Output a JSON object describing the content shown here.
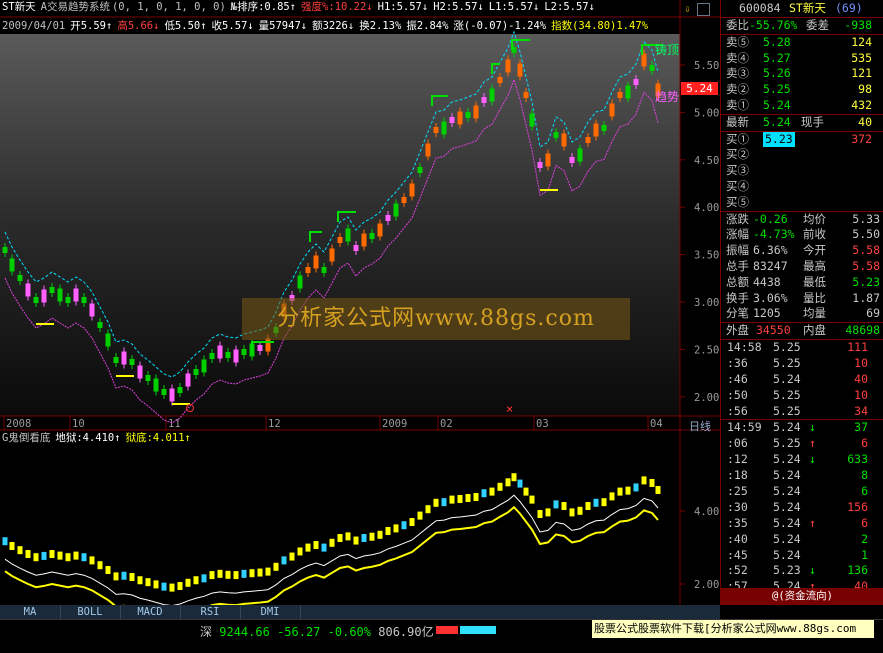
{
  "header": {
    "stock_name": "ST新天",
    "indicator_name": "A交易趋势系统",
    "indicator_params": "(0, 1, 0, 1, 0, 0)",
    "rank": "№排序:0.85↑",
    "strength": "强度%:10.22↓",
    "h1": "H1:5.57↓",
    "h2": "H2:5.57↓",
    "l1": "L1:5.57↓",
    "l2": "L2:5.57↓",
    "date": "2009/04/01",
    "open": "开5.59↑",
    "high": "高5.66↓",
    "low": "低5.50↑",
    "close": "收5.57↓",
    "volume": "量57947↓",
    "amount": "额3226↓",
    "turnover": "换2.13%",
    "amplitude": "振2.84%",
    "change": "涨(-0.07)-1.24%",
    "index": "指数(34.80)1.47%"
  },
  "labels": {
    "top_tag": "铸顶",
    "trend_tag": "趋势",
    "price_tag": "5.24",
    "period": "日线",
    "watermark": "分析家公式网www.88gs.com",
    "sub_title": "G鬼倒看底",
    "sub_hell": "地狱:4.410↑",
    "sub_bottom": "狱底:4.011↑"
  },
  "y_axis_main": [
    "5.50",
    "5.00",
    "4.50",
    "4.00",
    "3.50",
    "3.00",
    "2.50",
    "2.00"
  ],
  "y_axis_sub": [
    "4.00",
    "2.00"
  ],
  "x_axis": [
    "2008",
    "10",
    "11",
    "12",
    "2009",
    "02",
    "03",
    "04"
  ],
  "tabs": [
    "MA",
    "BOLL",
    "MACD",
    "RSI",
    "DMI"
  ],
  "quote": {
    "code": "600084",
    "name": "ST新天",
    "rank": "(69)",
    "ratio_label": "委比",
    "ratio_value": "-55.76%",
    "diff_label": "委差",
    "diff_value": "-938",
    "asks": [
      {
        "label": "卖⑤",
        "price": "5.28",
        "vol": "124"
      },
      {
        "label": "卖④",
        "price": "5.27",
        "vol": "535"
      },
      {
        "label": "卖③",
        "price": "5.26",
        "vol": "121"
      },
      {
        "label": "卖②",
        "price": "5.25",
        "vol": "98"
      },
      {
        "label": "卖①",
        "price": "5.24",
        "vol": "432"
      }
    ],
    "last_label": "最新",
    "last_value": "5.24",
    "curvol_label": "现手",
    "curvol_value": "40",
    "bids": [
      {
        "label": "买①",
        "price": "5.23",
        "vol": "372"
      },
      {
        "label": "买②",
        "price": "",
        "vol": ""
      },
      {
        "label": "买③",
        "price": "",
        "vol": ""
      },
      {
        "label": "买④",
        "price": "",
        "vol": ""
      },
      {
        "label": "买⑤",
        "price": "",
        "vol": ""
      }
    ],
    "stats": [
      {
        "l1": "涨跌",
        "v1": "-0.26",
        "l2": "均价",
        "v2": "5.33",
        "c1": "#00e000",
        "c2": "#c8c8c8"
      },
      {
        "l1": "涨幅",
        "v1": "-4.73%",
        "l2": "前收",
        "v2": "5.50",
        "c1": "#00e000",
        "c2": "#c8c8c8"
      },
      {
        "l1": "振幅",
        "v1": "6.36%",
        "l2": "今开",
        "v2": "5.58",
        "c1": "#c8c8c8",
        "c2": "#ff4040"
      },
      {
        "l1": "总手",
        "v1": "83247",
        "l2": "最高",
        "v2": "5.58",
        "c1": "#c8c8c8",
        "c2": "#ff4040"
      },
      {
        "l1": "总额",
        "v1": "4438",
        "l2": "最低",
        "v2": "5.23",
        "c1": "#c8c8c8",
        "c2": "#00e000"
      },
      {
        "l1": "换手",
        "v1": "3.06%",
        "l2": "量比",
        "v2": "1.87",
        "c1": "#c8c8c8",
        "c2": "#c8c8c8"
      },
      {
        "l1": "分笔",
        "v1": "1205",
        "l2": "均量",
        "v2": "69",
        "c1": "#c8c8c8",
        "c2": "#c8c8c8"
      }
    ],
    "outer_label": "外盘",
    "outer_value": "34550",
    "inner_label": "内盘",
    "inner_value": "48698"
  },
  "ticks": [
    {
      "time": "14:58",
      "price": "5.25",
      "arrow": "",
      "vol": "111",
      "color": "#ff4040"
    },
    {
      "time": ":36",
      "price": "5.25",
      "arrow": "",
      "vol": "10",
      "color": "#ff4040"
    },
    {
      "time": ":46",
      "price": "5.24",
      "arrow": "",
      "vol": "40",
      "color": "#ff4040"
    },
    {
      "time": ":50",
      "price": "5.25",
      "arrow": "",
      "vol": "10",
      "color": "#ff4040"
    },
    {
      "time": ":56",
      "price": "5.25",
      "arrow": "",
      "vol": "34",
      "color": "#ff4040"
    },
    {
      "time": "14:59",
      "price": "5.24",
      "arrow": "↓",
      "vol": "37",
      "color": "#00e000"
    },
    {
      "time": ":06",
      "price": "5.25",
      "arrow": "↑",
      "vol": "6",
      "color": "#ff4040"
    },
    {
      "time": ":12",
      "price": "5.24",
      "arrow": "↓",
      "vol": "633",
      "color": "#00e000"
    },
    {
      "time": ":18",
      "price": "5.24",
      "arrow": "",
      "vol": "8",
      "color": "#00e000"
    },
    {
      "time": ":25",
      "price": "5.24",
      "arrow": "",
      "vol": "6",
      "color": "#00e000"
    },
    {
      "time": ":30",
      "price": "5.24",
      "arrow": "",
      "vol": "156",
      "color": "#ff4040"
    },
    {
      "time": ":35",
      "price": "5.24",
      "arrow": "↑",
      "vol": "6",
      "color": "#ff4040"
    },
    {
      "time": ":40",
      "price": "5.24",
      "arrow": "",
      "vol": "2",
      "color": "#00e000"
    },
    {
      "time": ":45",
      "price": "5.24",
      "arrow": "",
      "vol": "1",
      "color": "#00e000"
    },
    {
      "time": ":52",
      "price": "5.23",
      "arrow": "↓",
      "vol": "136",
      "color": "#00e000"
    },
    {
      "time": ":57",
      "price": "5.24",
      "arrow": "↑",
      "vol": "40",
      "color": "#ff4040"
    }
  ],
  "right_bottom_banner": "@(资金流向)",
  "status": {
    "index_name": "深",
    "index_value": "9244.66",
    "index_change": "-56.27",
    "index_pct": "-0.60%",
    "index_amount": "806.90亿",
    "ad_text": "股票公式股票软件下载[分析家公式网www.88gs.com"
  },
  "colors": {
    "up": "#ff6a00",
    "up_alt": "#ff60ff",
    "down": "#00d000",
    "guide": "#00e0ff",
    "trend": "#e040e0",
    "yellow": "#ffff00",
    "border": "#7a0000"
  }
}
